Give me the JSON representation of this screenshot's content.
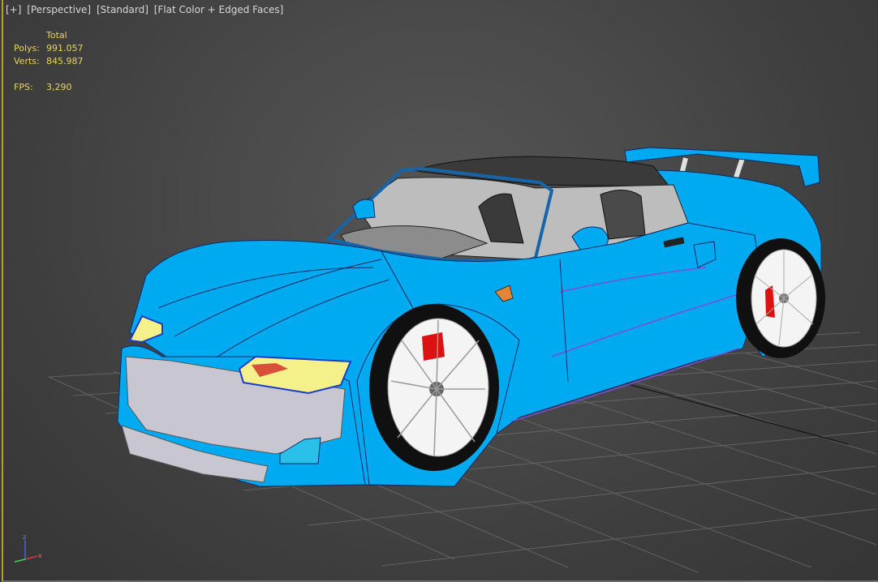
{
  "viewport": {
    "labels": [
      "[+]",
      "[Perspective]",
      "[Standard]",
      "[Flat Color + Edged Faces]"
    ]
  },
  "stats": {
    "header": "Total",
    "polys_label": "Polys:",
    "polys": "991.057",
    "verts_label": "Verts:",
    "verts": "845.987",
    "fps_label": "FPS:",
    "fps": "3,290"
  },
  "gizmo": {
    "z": "z",
    "x": "x"
  },
  "colors": {
    "body": "#00aaf0",
    "roof": "#3a3a3a",
    "interior": "#bdbdbd",
    "wheel": "#f4f4f4",
    "tire": "#101010",
    "brake": "#dd1111",
    "grid": "#6e6e6e",
    "stats_text": "#e9d45a"
  },
  "icons": [
    "axis-tripod-icon"
  ]
}
